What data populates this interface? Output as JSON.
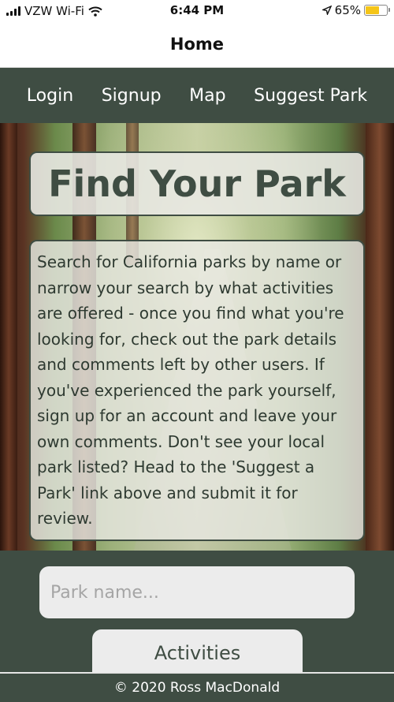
{
  "status_bar": {
    "carrier": "VZW Wi-Fi",
    "time": "6:44 PM",
    "battery": "65%",
    "battery_level": 0.65,
    "icons": [
      "signal-icon",
      "wifi-icon",
      "location-arrow-icon",
      "battery-icon"
    ]
  },
  "header": {
    "title": "Home"
  },
  "nav": {
    "login": "Login",
    "signup": "Signup",
    "map": "Map",
    "suggest_park": "Suggest Park"
  },
  "hero": {
    "title": "Find Your Park",
    "description": "Search for California parks by name or narrow your search by what activities are offered - once you find what you're looking for, check out the park details and comments left by other users. If you've experienced the park yourself, sign up for an account and leave your own comments. Don't see your local park listed? Head to the 'Suggest a Park' link above and submit it for review."
  },
  "search": {
    "placeholder": "Park name...",
    "value": "",
    "activities_label": "Activities"
  },
  "footer": {
    "text": "© 2020 Ross MacDonald"
  },
  "colors": {
    "brand_dark_green": "#3f4d43",
    "panel_light": "#ececec",
    "battery_yellow": "#f5c518"
  }
}
